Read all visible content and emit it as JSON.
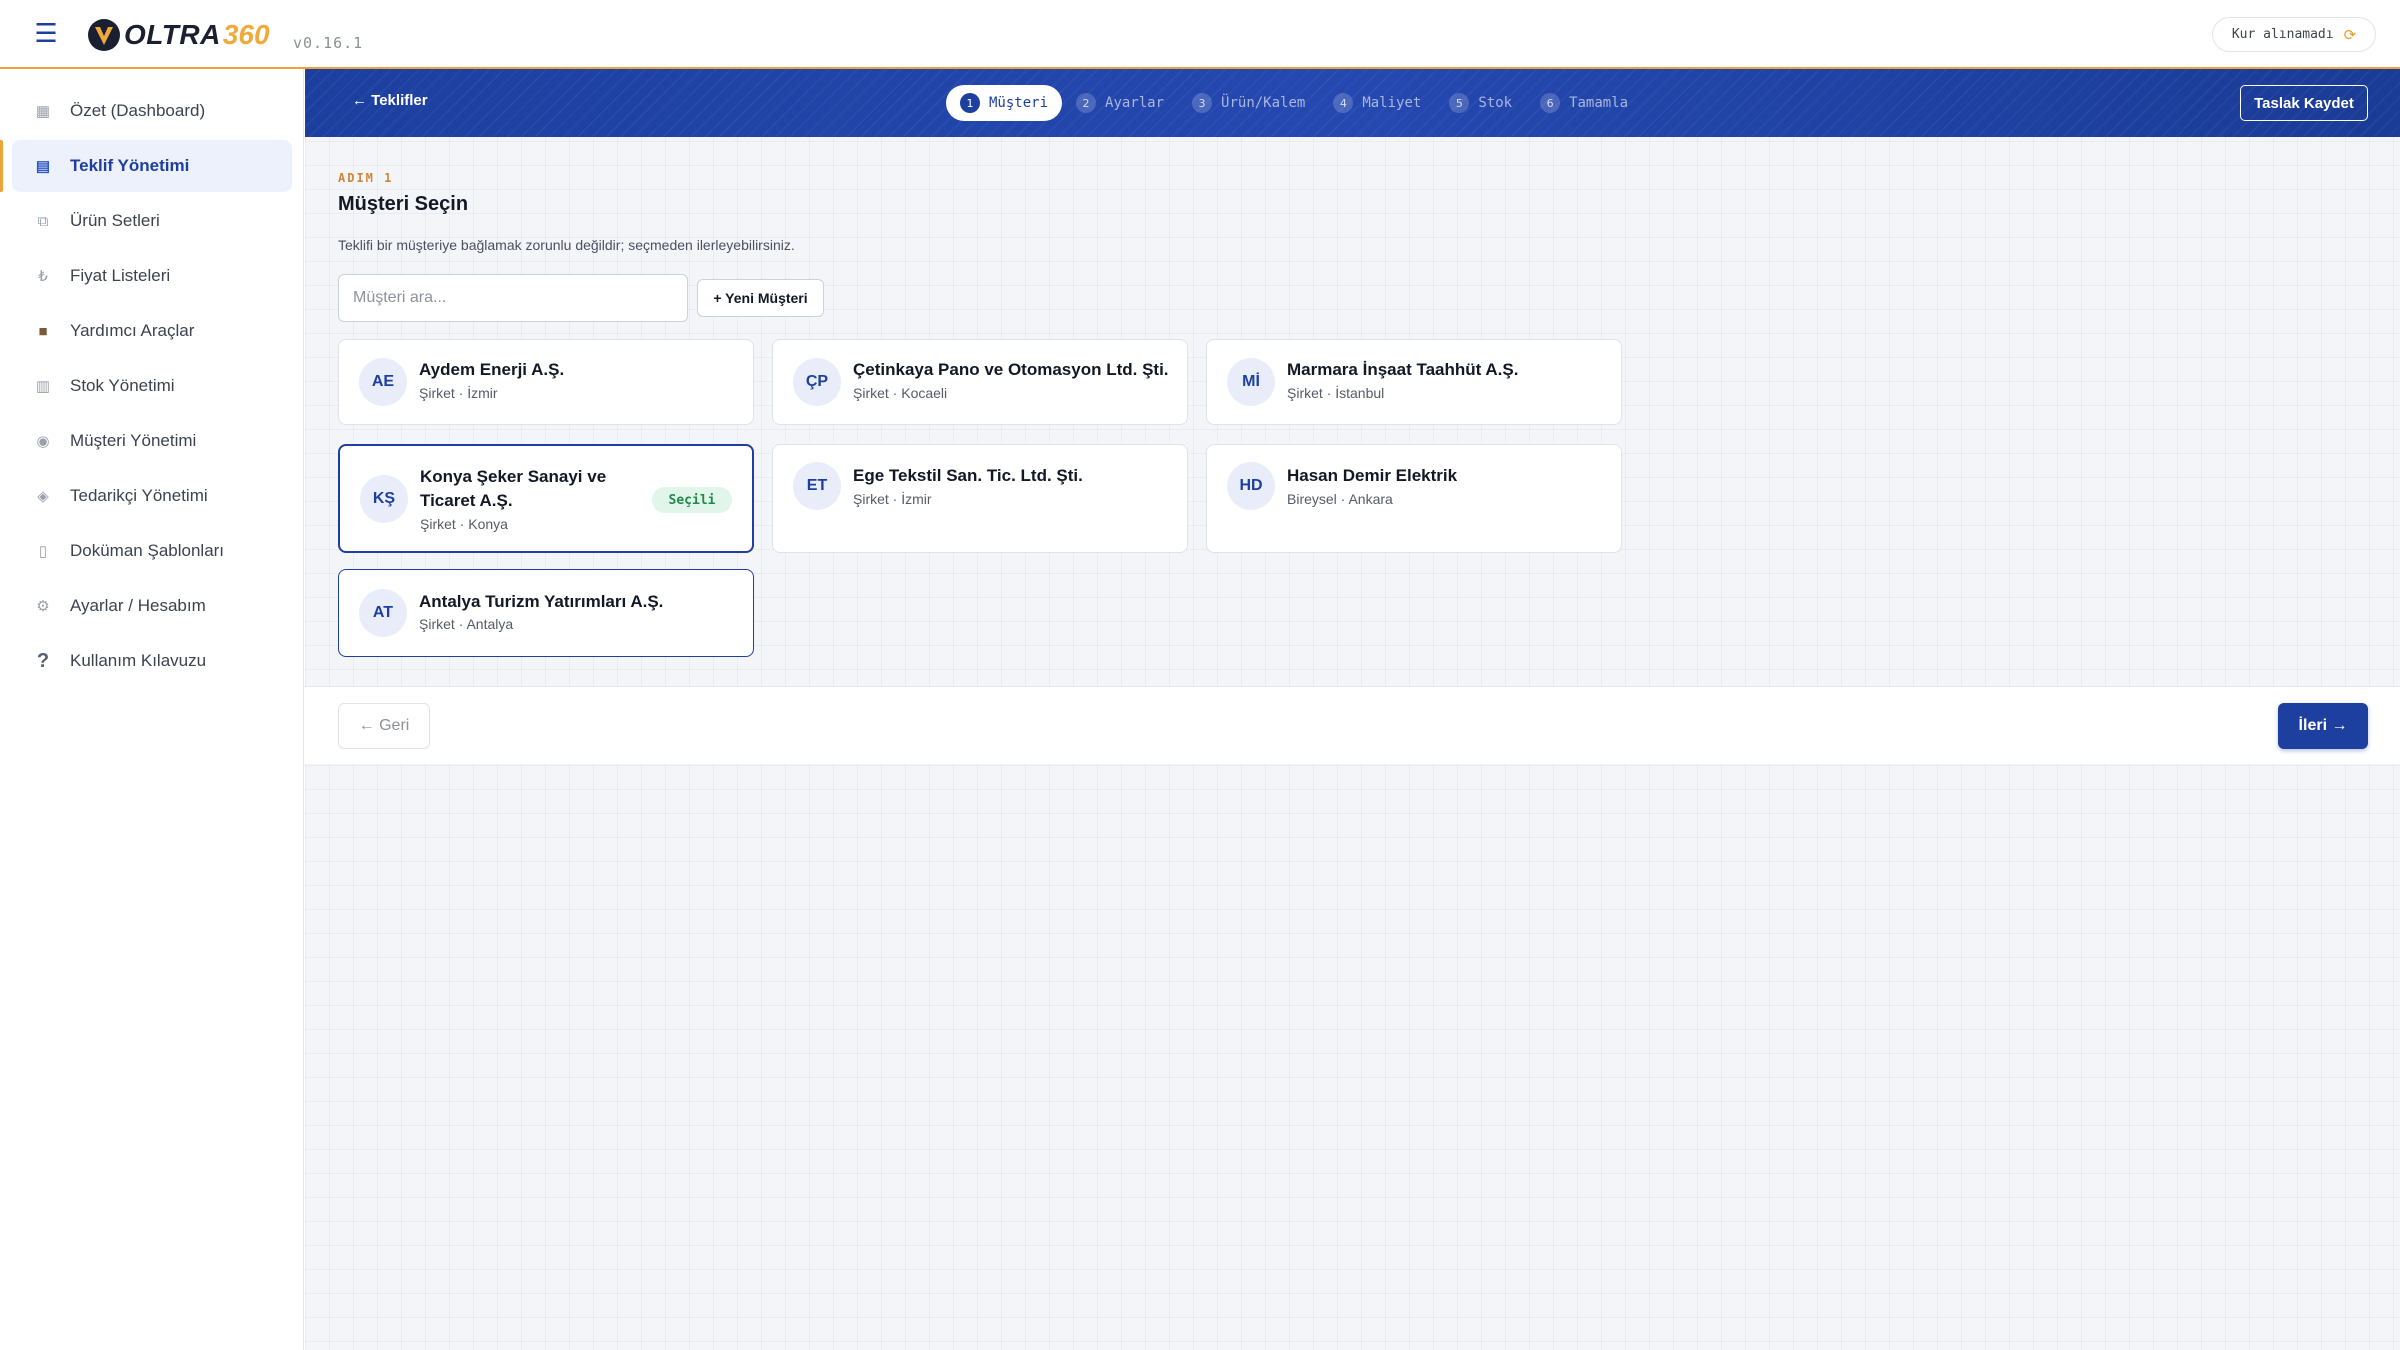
{
  "header": {
    "logo_text": "OLTRA",
    "logo_number": "360",
    "version": "v0.16.1",
    "exchange_rate_status": "Kur alınamadı",
    "menu_icon": "hamburger-icon"
  },
  "sidebar": {
    "items": [
      {
        "label": "Özet (Dashboard)",
        "icon": "dashboard-icon",
        "active": false
      },
      {
        "label": "Teklif Yönetimi",
        "icon": "document-icon",
        "active": true
      },
      {
        "label": "Ürün Setleri",
        "icon": "layers-icon",
        "active": false
      },
      {
        "label": "Fiyat Listeleri",
        "icon": "lira-icon",
        "active": false
      },
      {
        "label": "Yardımcı Araçlar",
        "icon": "toolbox-icon",
        "active": false
      },
      {
        "label": "Stok Yönetimi",
        "icon": "stock-icon",
        "active": false
      },
      {
        "label": "Müşteri Yönetimi",
        "icon": "customer-icon",
        "active": false
      },
      {
        "label": "Tedarikçi Yönetimi",
        "icon": "supplier-icon",
        "active": false
      },
      {
        "label": "Doküman Şablonları",
        "icon": "file-icon",
        "active": false
      },
      {
        "label": "Ayarlar / Hesabım",
        "icon": "gear-icon",
        "active": false
      },
      {
        "label": "Kullanım Kılavuzu",
        "icon": "help-icon",
        "active": false
      }
    ]
  },
  "stepsbar": {
    "back_label": "← Teklifler",
    "save_draft_label": "Taslak Kaydet",
    "steps": [
      {
        "num": "1",
        "label": "Müşteri",
        "active": true
      },
      {
        "num": "2",
        "label": "Ayarlar",
        "active": false
      },
      {
        "num": "3",
        "label": "Ürün/Kalem",
        "active": false
      },
      {
        "num": "4",
        "label": "Maliyet",
        "active": false
      },
      {
        "num": "5",
        "label": "Stok",
        "active": false
      },
      {
        "num": "6",
        "label": "Tamamla",
        "active": false
      }
    ]
  },
  "content": {
    "step_tag": "ADIM 1",
    "title": "Müşteri Seçin",
    "description": "Teklifi bir müşteriye bağlamak zorunlu değildir; seçmeden ilerleyebilirsiniz.",
    "search_placeholder": "Müşteri ara...",
    "new_customer_label": "+ Yeni Müşteri",
    "selected_badge": "Seçili",
    "customers": [
      {
        "initials": "AE",
        "name": "Aydem Enerji A.Ş.",
        "meta": "Şirket · İzmir",
        "selected": false
      },
      {
        "initials": "ÇP",
        "name": "Çetinkaya Pano ve Otomasyon Ltd. Şti.",
        "meta": "Şirket · Kocaeli",
        "selected": false
      },
      {
        "initials": "Mİ",
        "name": "Marmara İnşaat Taahhüt A.Ş.",
        "meta": "Şirket · İstanbul",
        "selected": false
      },
      {
        "initials": "KŞ",
        "name": "Konya Şeker Sanayi ve Ticaret A.Ş.",
        "meta": "Şirket · Konya",
        "selected": true
      },
      {
        "initials": "ET",
        "name": "Ege Tekstil San. Tic. Ltd. Şti.",
        "meta": "Şirket · İzmir",
        "selected": false
      },
      {
        "initials": "HD",
        "name": "Hasan Demir Elektrik",
        "meta": "Bireysel · Ankara",
        "selected": false
      },
      {
        "initials": "AT",
        "name": "Antalya Turizm Yatırımları A.Ş.",
        "meta": "Şirket · Antalya",
        "selected": false
      }
    ]
  },
  "footer": {
    "back_label": "← Geri",
    "next_label": "İleri →"
  },
  "colors": {
    "primary": "#1d3fa0",
    "accent": "#f0a23a",
    "success": "#1f8a4c"
  }
}
